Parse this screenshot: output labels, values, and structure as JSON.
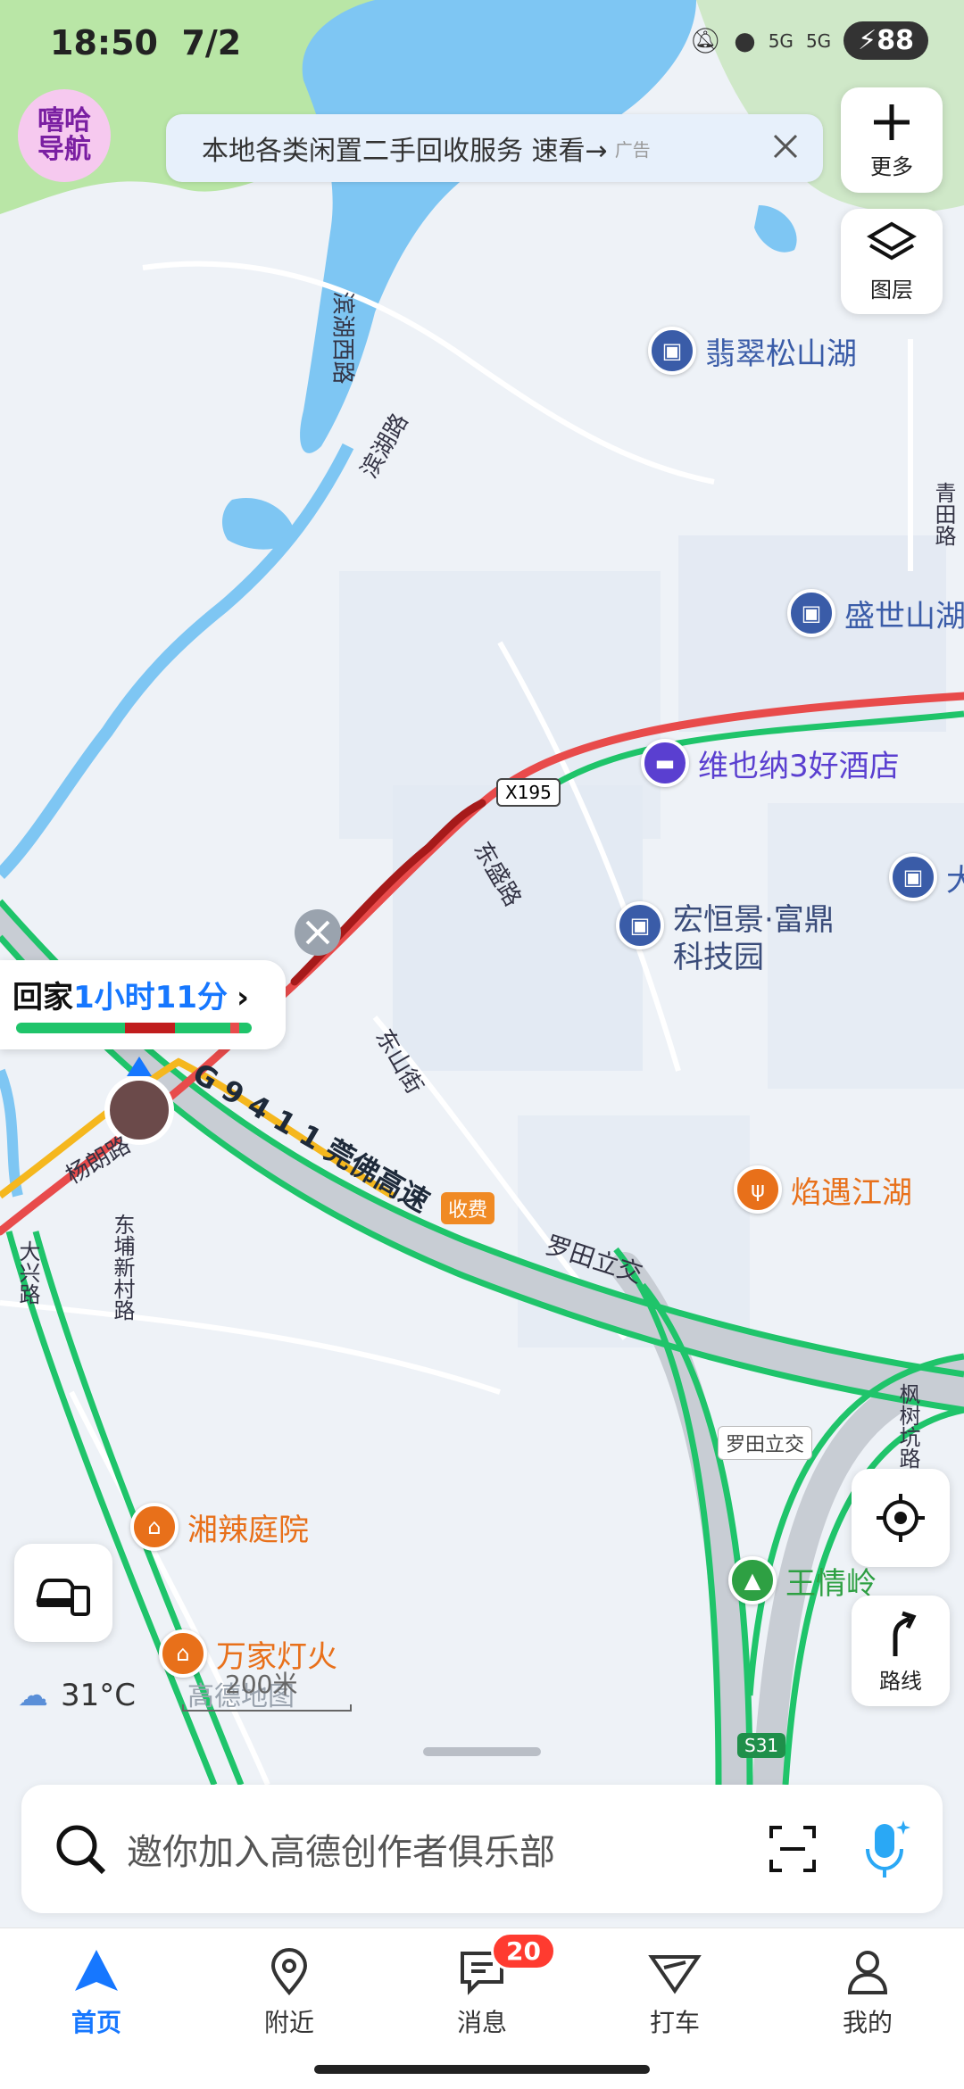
{
  "status_bar": {
    "time": "18:50",
    "date": "7/2",
    "signal_1": "5G",
    "signal_2": "5G",
    "battery": "88"
  },
  "logo": {
    "text": "嘻哈导航"
  },
  "ad_banner": {
    "text": "本地各类闲置二手回收服务 速看→",
    "tag": "广告"
  },
  "controls": {
    "more_label": "更多",
    "layers_label": "图层",
    "route_label": "路线"
  },
  "map": {
    "road_labels": [
      "滨湖西路",
      "滨湖路",
      "青田路",
      "东盛路",
      "东山街",
      "杨朗路",
      "东埔新村路",
      "大兴路",
      "罗田立交",
      "枫树坑路",
      "G 9 4 1 1 莞佛高速"
    ],
    "shields": {
      "x195": "X195",
      "toll": "收费",
      "s31": "S31",
      "luotian": "罗田立交"
    },
    "pois": [
      {
        "name": "翡翠松山湖",
        "color": "#3a5ca8",
        "icon": "building-icon"
      },
      {
        "name": "盛世山湖",
        "color": "#3a5ca8",
        "icon": "building-icon"
      },
      {
        "name": "维也纳3好酒店",
        "color": "#5a3fd0",
        "icon": "hotel-icon"
      },
      {
        "name": "宏恒景·富鼎\n科技园",
        "color": "#3a4c7a",
        "icon": "building-icon"
      },
      {
        "name": "焰遇江湖",
        "color": "#e8701a",
        "icon": "restaurant-icon"
      },
      {
        "name": "湘辣庭院",
        "color": "#e8701a",
        "icon": "restaurant-icon"
      },
      {
        "name": "万家灯火",
        "color": "#e8701a",
        "icon": "restaurant-icon"
      },
      {
        "name": "王情岭",
        "color": "#2ea043",
        "icon": "mountain-icon"
      },
      {
        "name": "大",
        "color": "#3a5ca8",
        "icon": "building-icon"
      }
    ],
    "watermark": "高德地图",
    "scale": "200米",
    "weather": "31°C"
  },
  "route_card": {
    "label": "回家",
    "duration": "1小时11分"
  },
  "search": {
    "placeholder": "邀你加入高德创作者俱乐部"
  },
  "tabs": [
    {
      "label": "首页",
      "icon": "navigation-arrow-icon",
      "active": true
    },
    {
      "label": "附近",
      "icon": "location-pin-icon"
    },
    {
      "label": "消息",
      "icon": "message-icon",
      "badge": "20"
    },
    {
      "label": "打车",
      "icon": "taxi-icon"
    },
    {
      "label": "我的",
      "icon": "user-icon"
    }
  ],
  "colors": {
    "accent": "#1677ff",
    "traffic_green": "#1fc46a",
    "traffic_red": "#e84b4b",
    "traffic_dark_red": "#a61a1a",
    "traffic_yellow": "#f5b71e"
  }
}
